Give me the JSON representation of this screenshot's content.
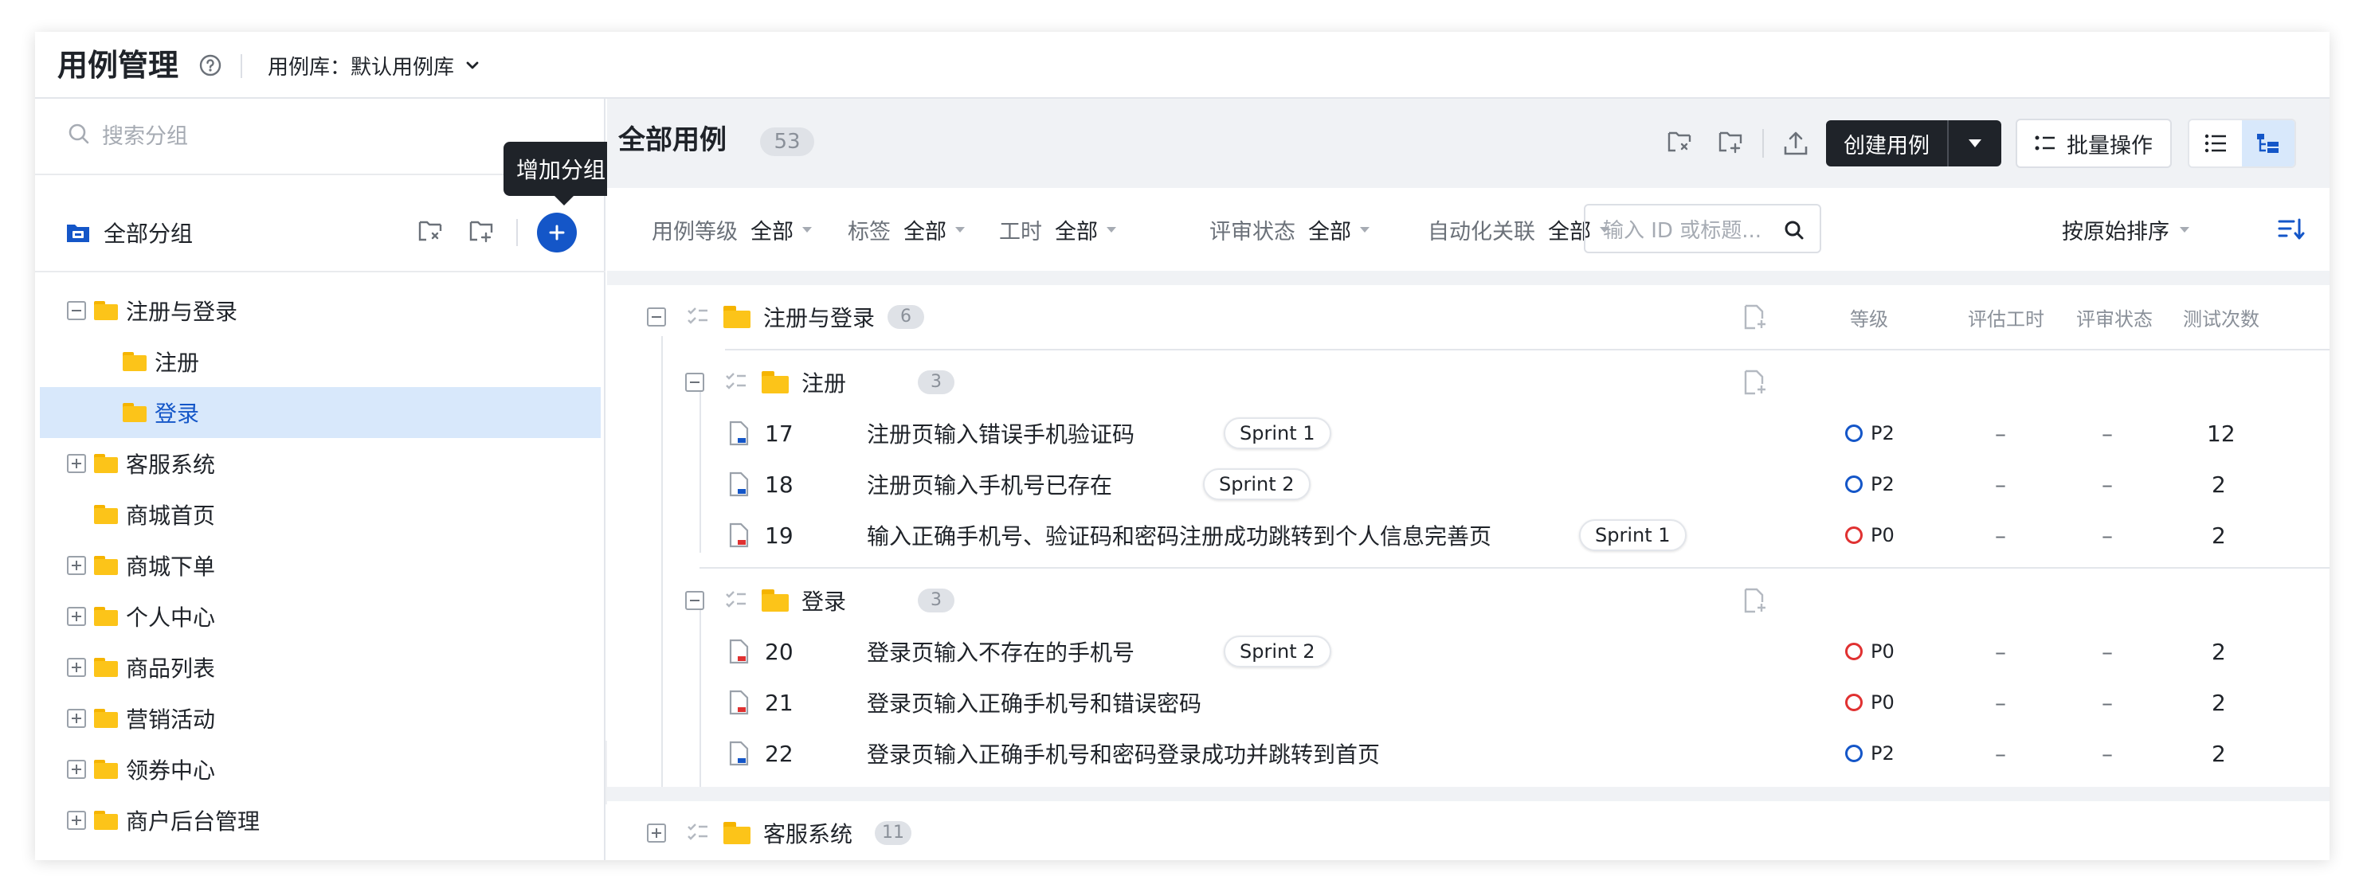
{
  "header": {
    "title": "用例管理",
    "library_label": "用例库：默认用例库"
  },
  "sidebar": {
    "search_placeholder": "搜索分组",
    "all_groups_label": "全部分组",
    "add_tooltip": "增加分组",
    "tree": [
      {
        "label": "注册与登录",
        "level": 0,
        "toggle": "minus"
      },
      {
        "label": "注册",
        "level": 1,
        "toggle": "none"
      },
      {
        "label": "登录",
        "level": 1,
        "toggle": "none",
        "selected": true
      },
      {
        "label": "客服系统",
        "level": 0,
        "toggle": "plus"
      },
      {
        "label": "商城首页",
        "level": 0,
        "toggle": "none"
      },
      {
        "label": "商城下单",
        "level": 0,
        "toggle": "plus"
      },
      {
        "label": "个人中心",
        "level": 0,
        "toggle": "plus"
      },
      {
        "label": "商品列表",
        "level": 0,
        "toggle": "plus"
      },
      {
        "label": "营销活动",
        "level": 0,
        "toggle": "plus"
      },
      {
        "label": "领券中心",
        "level": 0,
        "toggle": "plus"
      },
      {
        "label": "商户后台管理",
        "level": 0,
        "toggle": "plus"
      }
    ],
    "collapse_glyph": "«"
  },
  "main": {
    "title": "全部用例",
    "count": "53",
    "create_label": "创建用例",
    "batch_label": "批量操作",
    "filters": [
      {
        "key": "用例等级",
        "value": "全部"
      },
      {
        "key": "标签",
        "value": "全部"
      },
      {
        "key": "工时",
        "value": "全部"
      },
      {
        "key": "评审状态",
        "value": "全部"
      },
      {
        "key": "自动化关联",
        "value": "全部"
      }
    ],
    "search_placeholder": "输入 ID 或标题...",
    "sort_label": "按原始排序",
    "columns": [
      "等级",
      "评估工时",
      "评审状态",
      "测试次数"
    ],
    "groups": {
      "g1": {
        "name": "注册与登录",
        "count": "6"
      },
      "g1a": {
        "name": "注册",
        "count": "3"
      },
      "g1b": {
        "name": "登录",
        "count": "3"
      },
      "g2": {
        "name": "客服系统",
        "count": "11"
      }
    },
    "cases": [
      {
        "id": "17",
        "title": "注册页输入错误手机验证码",
        "tag": "Sprint 1",
        "priority": "P2",
        "hours": "–",
        "review": "–",
        "runs": "12"
      },
      {
        "id": "18",
        "title": "注册页输入手机号已存在",
        "tag": "Sprint 2",
        "priority": "P2",
        "hours": "–",
        "review": "–",
        "runs": "2"
      },
      {
        "id": "19",
        "title": "输入正确手机号、验证码和密码注册成功跳转到个人信息完善页",
        "tag": "Sprint 1",
        "priority": "P0",
        "hours": "–",
        "review": "–",
        "runs": "2"
      },
      {
        "id": "20",
        "title": "登录页输入不存在的手机号",
        "tag": "Sprint 2",
        "priority": "P0",
        "hours": "–",
        "review": "–",
        "runs": "2"
      },
      {
        "id": "21",
        "title": "登录页输入正确手机号和错误密码",
        "tag": "",
        "priority": "P0",
        "hours": "–",
        "review": "–",
        "runs": "2"
      },
      {
        "id": "22",
        "title": "登录页输入正确手机号和密码登录成功并跳转到首页",
        "tag": "",
        "priority": "P2",
        "hours": "–",
        "review": "–",
        "runs": "2"
      }
    ],
    "colors": {
      "accent": "#1456c8",
      "p0": "#e03131",
      "p2": "#1456c8",
      "folder": "#fcc419"
    }
  }
}
